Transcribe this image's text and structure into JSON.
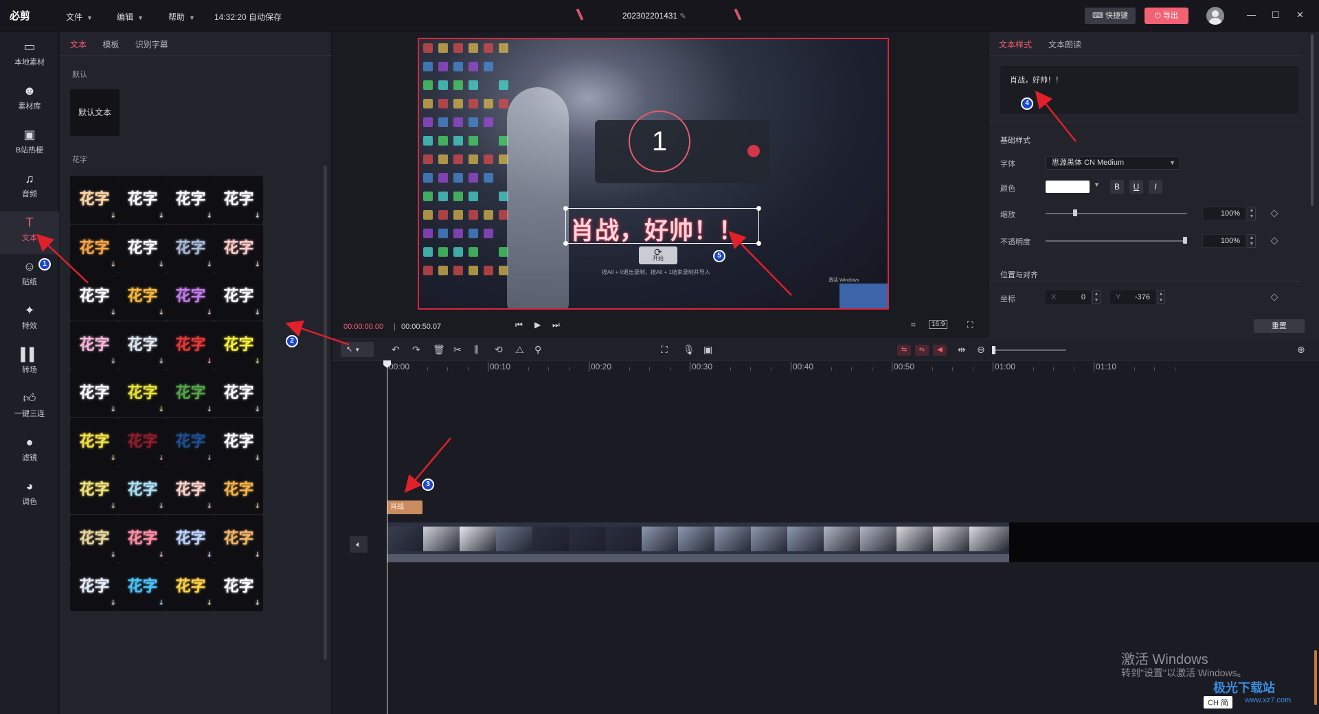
{
  "app": {
    "logo": "必剪",
    "menus": [
      "文件",
      "编辑",
      "帮助"
    ],
    "autosave": "14:32:20 自动保存",
    "project_name": "202302201431",
    "shortcut_label": "快捷键",
    "export_label": "导出",
    "window_controls": [
      "—",
      "☐",
      "✕"
    ]
  },
  "rail": [
    {
      "label": "本地素材",
      "icon": "folder-icon"
    },
    {
      "label": "素材库",
      "icon": "bili-icon"
    },
    {
      "label": "B站热梗",
      "icon": "tv-icon"
    },
    {
      "label": "音频",
      "icon": "music-icon"
    },
    {
      "label": "文本",
      "icon": "text-icon",
      "active": true
    },
    {
      "label": "贴纸",
      "icon": "sticker-icon"
    },
    {
      "label": "特效",
      "icon": "effect-icon"
    },
    {
      "label": "转场",
      "icon": "transition-icon"
    },
    {
      "label": "一键三连",
      "icon": "thumbs-up-icon"
    },
    {
      "label": "滤镜",
      "icon": "filter-icon"
    },
    {
      "label": "调色",
      "icon": "palette-icon"
    }
  ],
  "text_panel": {
    "tabs": [
      "文本",
      "模板",
      "识别字幕"
    ],
    "section_default": "默认",
    "default_tile": "默认文本",
    "section_fancy": "花字",
    "fancy_label": "花字",
    "fancy_styles": [
      [
        "#ffd7a8",
        "#ffffff",
        "#ffffff",
        "#ffffff"
      ],
      [
        "#f6a54a",
        "#ffffff",
        "#a9b8d6",
        "#ffc9c9"
      ],
      [
        "#ffffff",
        "#f5b942",
        "#c07be6",
        "#ffffff"
      ],
      [
        "#f7b6d9",
        "#dfe7f2",
        "#e23a3a",
        "#f5ef3c"
      ],
      [
        "#ffffff",
        "#e6e13a",
        "#56a34c",
        "#ffffff"
      ],
      [
        "#f2e14a",
        "#8a1f2b",
        "#214d8c",
        "#ffffff"
      ],
      [
        "#f1e27a",
        "#aee0f5",
        "#ffd2c8",
        "#f3b34a"
      ],
      [
        "#e8d6a0",
        "#ff8fa8",
        "#bcd4ff",
        "#f0b46a"
      ],
      [
        "#e7eefc",
        "#4fc3f7",
        "#ffd24a",
        "#ffffff"
      ]
    ]
  },
  "preview": {
    "countdown": "1",
    "overlay_text": "肖战，好帅！！",
    "start_button": "开始",
    "hint": "按Alt + 0退出录制，按Alt + 1结束录制并导入",
    "activate_hint": "激活 Windows",
    "time_current": "00:00:00.00",
    "time_total": "00:00:50.07",
    "ratio": "16:9"
  },
  "props": {
    "tabs": [
      "文本样式",
      "文本朗读"
    ],
    "text_value": "肖战，好帅！！",
    "section_basic": "基础样式",
    "font_label": "字体",
    "font_value": "思源黑体 CN Medium",
    "color_label": "颜色",
    "color_value": "#ffffff",
    "bold": "B",
    "underline": "U",
    "italic": "I",
    "scale_label": "缩放",
    "scale_value": "100%",
    "scale_fraction": 0.2,
    "opacity_label": "不透明度",
    "opacity_value": "100%",
    "opacity_fraction": 1.0,
    "section_position": "位置与对齐",
    "coord_label": "坐标",
    "x_axis": "X",
    "y_axis": "Y",
    "x_value": "0",
    "y_value": "-376",
    "reset_label": "重置"
  },
  "timeline": {
    "ruler": [
      "00:00",
      "00:10",
      "00:20",
      "00:30",
      "00:40",
      "00:50",
      "01:00",
      "01:10"
    ],
    "text_clip_label": "肖战"
  },
  "annotations": [
    "1",
    "2",
    "3",
    "4",
    "5"
  ],
  "watermark": {
    "line1": "激活 Windows",
    "line2": "转到\"设置\"以激活 Windows。",
    "site": "极光下载站",
    "url": "www.xz7.com",
    "ime": "CH 简"
  }
}
